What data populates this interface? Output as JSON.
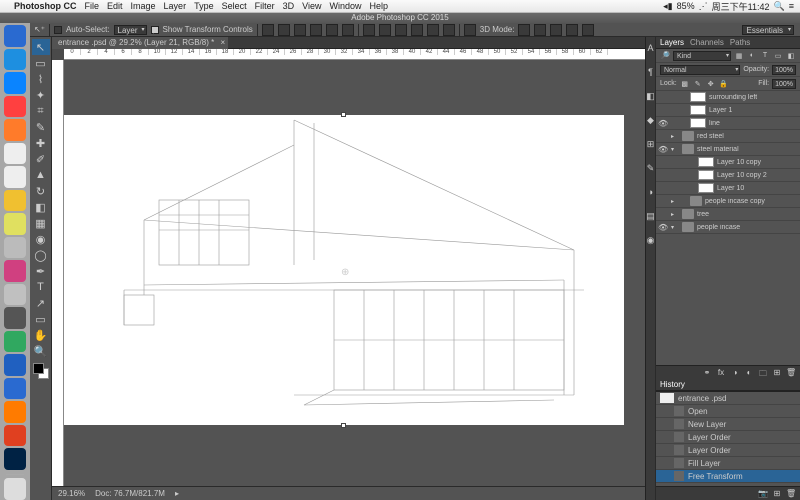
{
  "menubar": {
    "app": "Photoshop CC",
    "items": [
      "File",
      "Edit",
      "Image",
      "Layer",
      "Type",
      "Select",
      "Filter",
      "3D",
      "View",
      "Window",
      "Help"
    ],
    "battery": "85%",
    "clock": "周三下午11:42"
  },
  "window_title": "Adobe Photoshop CC 2015",
  "workspace": "Essentials",
  "optbar": {
    "auto_select": "Auto-Select:",
    "auto_select_val": "Layer",
    "show_transform": "Show Transform Controls",
    "mode_3d": "3D Mode:"
  },
  "doc_tab": "entrance .psd @ 29.2% (Layer 21, RGB/8) *",
  "ruler_marks": [
    "0",
    "2",
    "4",
    "6",
    "8",
    "10",
    "12",
    "14",
    "16",
    "18",
    "20",
    "22",
    "24",
    "26",
    "28",
    "30",
    "32",
    "34",
    "36",
    "38",
    "40",
    "42",
    "44",
    "46",
    "48",
    "50",
    "52",
    "54",
    "56",
    "58",
    "60",
    "62"
  ],
  "status": {
    "zoom": "29.16%",
    "doc": "Doc: 76.7M/821.7M"
  },
  "layers_panel": {
    "tabs": [
      "Layers",
      "Channels",
      "Paths"
    ],
    "filter": "Kind",
    "blend": "Normal",
    "opacity_lbl": "Opacity:",
    "opacity_val": "100%",
    "lock_lbl": "Lock:",
    "fill_lbl": "Fill:",
    "fill_val": "100%",
    "layers": [
      {
        "name": "surrounding left",
        "type": "layer",
        "indent": 1
      },
      {
        "name": "Layer 1",
        "type": "layer",
        "indent": 1
      },
      {
        "name": "line",
        "type": "layer",
        "indent": 1,
        "eye": true
      },
      {
        "name": "red steel",
        "type": "folder",
        "indent": 0,
        "closed": true
      },
      {
        "name": "steel material",
        "type": "folder",
        "indent": 0,
        "open": true,
        "eye": true
      },
      {
        "name": "Layer 10 copy",
        "type": "layer",
        "indent": 2
      },
      {
        "name": "Layer 10 copy 2",
        "type": "layer",
        "indent": 2
      },
      {
        "name": "Layer 10",
        "type": "layer",
        "indent": 2
      },
      {
        "name": "people incase copy",
        "type": "folder",
        "indent": 1,
        "closed": true
      },
      {
        "name": "tree",
        "type": "folder",
        "indent": 0,
        "closed": true
      },
      {
        "name": "people incase",
        "type": "folder",
        "indent": 0,
        "open": true,
        "eye": true
      }
    ]
  },
  "history_panel": {
    "tab": "History",
    "doc": "entrance .psd",
    "items": [
      "Open",
      "New Layer",
      "Layer Order",
      "Layer Order",
      "Fill Layer",
      "Free Transform"
    ]
  },
  "dock_colors": [
    "#2a6ad0",
    "#1e8fe0",
    "#0a84ff",
    "#ff4040",
    "#ff7b2a",
    "#eee",
    "#eee",
    "#f0c030",
    "#e0e060",
    "#bbb",
    "#d04080",
    "#c0c0c0",
    "#555",
    "#30a860",
    "#2060c0",
    "#2a6ad0",
    "#ff7b00",
    "#e04020",
    "#002244"
  ]
}
